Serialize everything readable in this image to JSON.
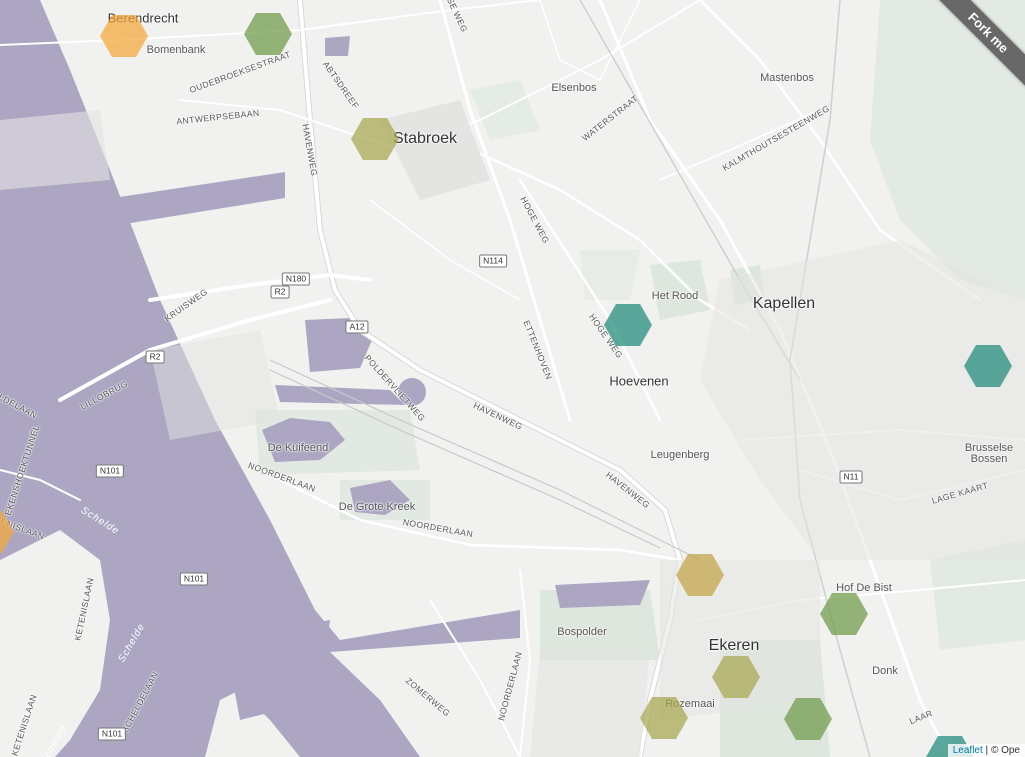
{
  "map": {
    "colors": {
      "land": "#f1f1ef",
      "water": "#aca6c2",
      "green": "#dde7de",
      "road": "#ffffff",
      "hex_orange": "#f4a83a",
      "hex_olive": "#a6a64e",
      "hex_green": "#6f9a4a",
      "hex_teal": "#1f8a7a"
    },
    "places": {
      "berendrecht": "Berendrecht",
      "bomenbank": "Bomenbank",
      "stabroek": "Stabroek",
      "elsenbos": "Elsenbos",
      "mastenbos": "Mastenbos",
      "kapellen": "Kapellen",
      "het_rood": "Het Rood",
      "hoevenen": "Hoevenen",
      "leugenberg": "Leugenberg",
      "brusselse_bossen": "Brusselse Bossen",
      "hof_de_bist": "Hof De Bist",
      "ekeren": "Ekeren",
      "donk": "Donk",
      "rozemaai": "Rozemaai",
      "bospolder": "Bospolder",
      "de_kuifeend": "De Kuifeend",
      "de_grote_kreek": "De Grote Kreek"
    },
    "streets": {
      "oudebroeksestraat": "OUDEBROEKSESTRAAT",
      "antwerpsebaan": "ANTWERPSEBAAN",
      "abtsdreef": "ABTSDREEF",
      "havenweg_1": "HAVENWEG",
      "havenweg_2": "HAVENWEG",
      "havenweg_3": "HAVENWEG",
      "waterstraat": "WATERSTRAAT",
      "kalmthoutsesteenweg": "KALMTHOUTSESTEENWEG",
      "hoge_weg_1": "HOGE WEG",
      "hoge_weg_2": "HOGE WEG",
      "ettenhoven": "ETTENHOVEN",
      "kruisweg": "KRUISWEG",
      "lillobrug": "LILLOBRUG",
      "poldervlietweg": "POLDERVLIETWEG",
      "noorderlaan_1": "NOORDERLAAN",
      "noorderlaan_2": "NOORDERLAAN",
      "noorderlaan_3": "NOORDERLAAN",
      "zomerweg": "ZOMERWEG",
      "scheldelaan": "SCHELDELAAN",
      "ketenislaan_1": "KETENISLAAN",
      "ketenislaan_2": "KETENISLAAN",
      "tenislaan": "TENISLAAN",
      "kennedytunnel": "EKENSHOEKTUNNEL",
      "lage_kaart": "LAGE KAART",
      "laar": "LAAR",
      "ldelaan": "LDELAAN",
      "se_weg": "RSE WEG"
    },
    "water_labels": {
      "schelde_1": "Schelde",
      "schelde_2": "Schelde",
      "schelde_3": "Schelde"
    },
    "shields": {
      "n180": "N180",
      "r2_a": "R2",
      "a12": "A12",
      "r2_b": "R2",
      "n114": "N114",
      "n101_a": "N101",
      "n101_b": "N101",
      "n101_c": "N101",
      "n11": "N11"
    }
  },
  "ribbon": {
    "label": "Fork me"
  },
  "attribution": {
    "leaflet": "Leaflet",
    "separator": "|",
    "rest": "© Ope"
  }
}
